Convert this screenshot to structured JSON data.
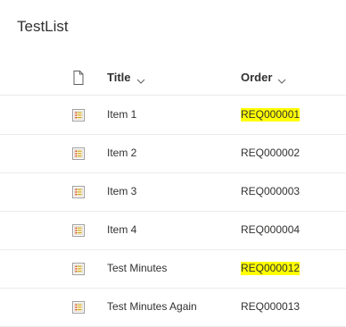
{
  "list": {
    "title": "TestList"
  },
  "columns": {
    "type_icon": "document-icon",
    "title": "Title",
    "order": "Order"
  },
  "rows": [
    {
      "icon": "list-item-icon",
      "title": "Item 1",
      "order": "REQ000001",
      "highlight": true
    },
    {
      "icon": "list-item-icon",
      "title": "Item 2",
      "order": "REQ000002",
      "highlight": false
    },
    {
      "icon": "list-item-icon",
      "title": "Item 3",
      "order": "REQ000003",
      "highlight": false
    },
    {
      "icon": "list-item-icon",
      "title": "Item 4",
      "order": "REQ000004",
      "highlight": false
    },
    {
      "icon": "list-item-icon",
      "title": "Test Minutes",
      "order": "REQ000012",
      "highlight": true
    },
    {
      "icon": "list-item-icon",
      "title": "Test Minutes Again",
      "order": "REQ000013",
      "highlight": false
    }
  ],
  "colors": {
    "highlight": "#ffff00",
    "divider": "#edebe9",
    "text": "#323130"
  }
}
